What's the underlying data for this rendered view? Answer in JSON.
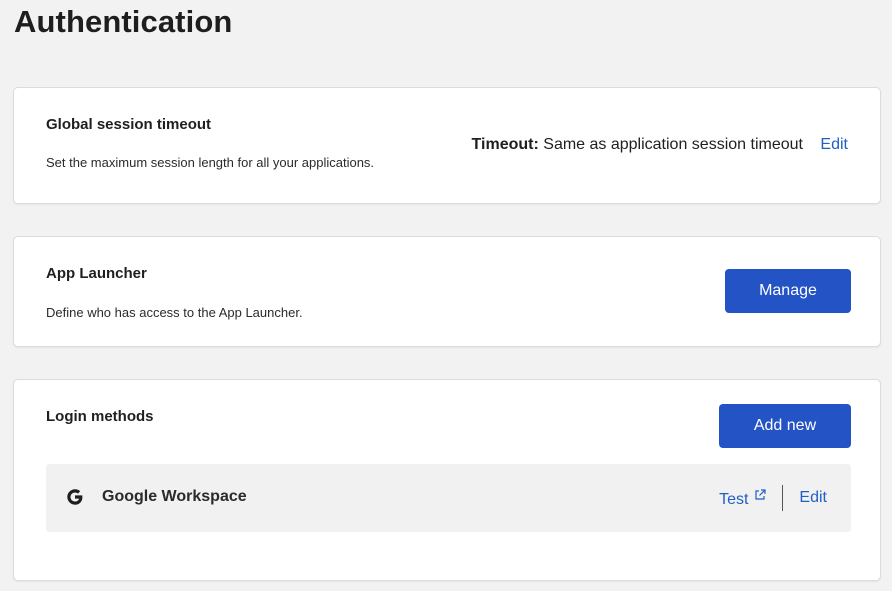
{
  "page": {
    "title": "Authentication"
  },
  "session_timeout": {
    "title": "Global session timeout",
    "description": "Set the maximum session length for all your applications.",
    "timeout_label": "Timeout:",
    "timeout_value": "Same as application session timeout",
    "edit_label": "Edit"
  },
  "app_launcher": {
    "title": "App Launcher",
    "description": "Define who has access to the App Launcher.",
    "manage_label": "Manage"
  },
  "login_methods": {
    "title": "Login methods",
    "add_new_label": "Add new",
    "methods": [
      {
        "name": "Google Workspace",
        "icon": "google-icon",
        "test_label": "Test",
        "edit_label": "Edit"
      }
    ]
  },
  "colors": {
    "primary_button": "#2453c6",
    "link": "#1f5fc6",
    "background": "#f2f2f2"
  }
}
